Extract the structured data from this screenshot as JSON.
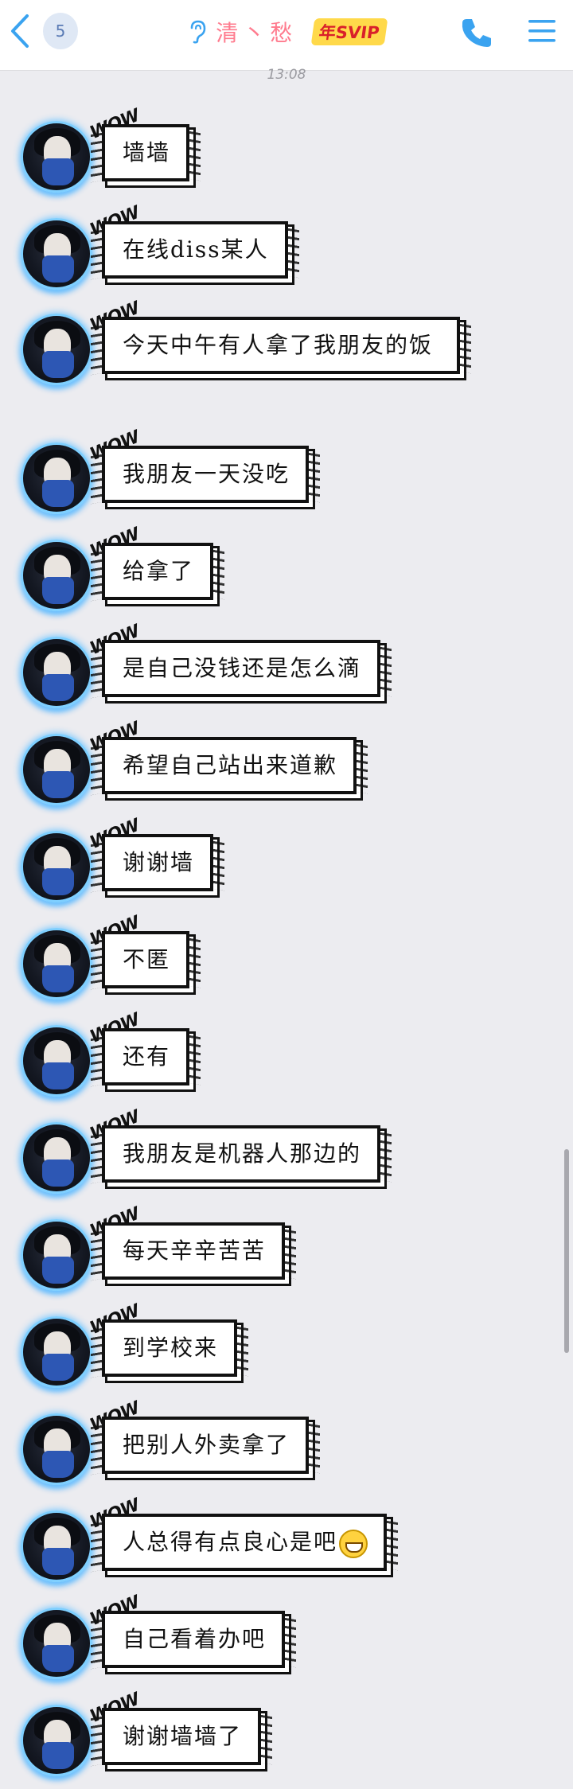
{
  "header": {
    "unread_count": "5",
    "contact_name": "清丶愁",
    "vip_badge": "年SVIP",
    "back_icon": "chevron-left-icon",
    "call_icon": "phone-icon",
    "menu_icon": "menu-icon",
    "accent_color": "#3aa3f0"
  },
  "timestamp": "13:08",
  "messages": [
    {
      "text": "墙墙"
    },
    {
      "text": "在线diss某人"
    },
    {
      "text": "今天中午有人拿了我朋友的饭"
    },
    {
      "text": "我朋友一天没吃"
    },
    {
      "text": "给拿了"
    },
    {
      "text": "是自己没钱还是怎么滴"
    },
    {
      "text": "希望自己站出来道歉"
    },
    {
      "text": "谢谢墙"
    },
    {
      "text": "不匿"
    },
    {
      "text": "还有"
    },
    {
      "text": "我朋友是机器人那边的"
    },
    {
      "text": "每天辛辛苦苦"
    },
    {
      "text": "到学校来"
    },
    {
      "text": "把别人外卖拿了"
    },
    {
      "text": "人总得有点良心是吧"
    },
    {
      "text": "自己看着办吧"
    },
    {
      "text": "谢谢墙墙了"
    }
  ],
  "sticker_text": "WOW"
}
